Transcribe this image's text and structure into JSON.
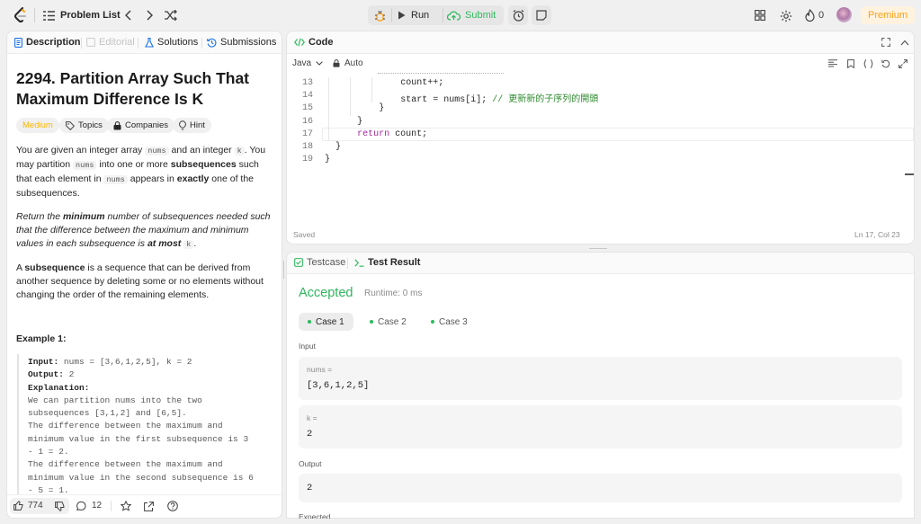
{
  "nav": {
    "problem_list": "Problem List",
    "run": "Run",
    "submit": "Submit",
    "streak": "0",
    "premium": "Premium"
  },
  "left_tabs": {
    "description": "Description",
    "editorial": "Editorial",
    "solutions": "Solutions",
    "submissions": "Submissions"
  },
  "problem": {
    "title_line1": "2294. Partition Array Such That",
    "title_line2": "Maximum Difference Is K",
    "difficulty": "Medium",
    "topics": "Topics",
    "companies": "Companies",
    "hint": "Hint",
    "p1": [
      {
        "t": "You are given an integer array "
      },
      {
        "c": "nums"
      },
      {
        "t": " and an integer "
      },
      {
        "c": "k"
      },
      {
        "t": ". You may partition "
      },
      {
        "c": "nums"
      },
      {
        "t": " into one or more "
      },
      {
        "b": "subsequences"
      },
      {
        "t": " such that each element in "
      },
      {
        "c": "nums"
      },
      {
        "t": " appears in "
      },
      {
        "b": "exactly"
      },
      {
        "t": " one of the subsequences."
      }
    ],
    "p2": [
      {
        "i": "Return the "
      },
      {
        "bi": "minimum"
      },
      {
        "i": " number of subsequences needed such that the difference between the maximum and minimum values in each subsequence is "
      },
      {
        "bi": "at most"
      },
      {
        "t": " "
      },
      {
        "c": "k"
      },
      {
        "t": "."
      }
    ],
    "p3": [
      {
        "t": "A "
      },
      {
        "b": "subsequence"
      },
      {
        "t": " is a sequence that can be derived from another sequence by deleting some or no elements without changing the order of the remaining elements."
      }
    ],
    "example_title": "Example 1:",
    "example_lines": [
      {
        "label": "Input:",
        "text": " nums = [3,6,1,2,5], k = 2"
      },
      {
        "label": "Output:",
        "text": " 2"
      },
      {
        "label": "Explanation:",
        "text": ""
      },
      {
        "label": "",
        "text": "We can partition nums into the two"
      },
      {
        "label": "",
        "text": "subsequences [3,1,2] and [6,5]."
      },
      {
        "label": "",
        "text": "The difference between the maximum and"
      },
      {
        "label": "",
        "text": "minimum value in the first subsequence is 3"
      },
      {
        "label": "",
        "text": "- 1 = 2."
      },
      {
        "label": "",
        "text": "The difference between the maximum and"
      },
      {
        "label": "",
        "text": "minimum value in the second subsequence is 6"
      },
      {
        "label": "",
        "text": "- 5 = 1."
      }
    ]
  },
  "footer": {
    "likes": "774",
    "comments": "12"
  },
  "code_panel": {
    "title": "Code",
    "language": "Java",
    "auto": "Auto",
    "saved": "Saved",
    "cursor": "Ln 17, Col 23",
    "lines": [
      {
        "n": "13",
        "indent": 7,
        "parts": [
          {
            "t": "count++;"
          }
        ]
      },
      {
        "n": "14",
        "indent": 7,
        "parts": [
          {
            "t": "start = nums[i]; "
          },
          {
            "cm": "// 更新新的子序列的開頭"
          }
        ]
      },
      {
        "n": "15",
        "indent": 5,
        "parts": [
          {
            "t": "}"
          }
        ]
      },
      {
        "n": "16",
        "indent": 3,
        "parts": [
          {
            "t": "}"
          }
        ]
      },
      {
        "n": "17",
        "indent": 3,
        "parts": [
          {
            "kw": "return"
          },
          {
            "t": " count;"
          }
        ]
      },
      {
        "n": "18",
        "indent": 1,
        "parts": [
          {
            "t": "}"
          }
        ]
      },
      {
        "n": "19",
        "indent": 0,
        "parts": [
          {
            "t": "}"
          }
        ]
      }
    ]
  },
  "result_panel": {
    "testcase_tab": "Testcase",
    "result_tab": "Test Result",
    "status": "Accepted",
    "runtime": "Runtime: 0 ms",
    "cases": [
      "Case 1",
      "Case 2",
      "Case 3"
    ],
    "input_label": "Input",
    "var1_name": "nums =",
    "var1_value": "[3,6,1,2,5]",
    "var2_name": "k =",
    "var2_value": "2",
    "output_label": "Output",
    "output_value": "2",
    "expected_label": "Expected"
  },
  "colors": {
    "accepted": "#2db55d",
    "medium": "#ffb800",
    "premium": "#ffa116",
    "premium_bg": "#fff3e0",
    "submit": "#2cbb5d"
  }
}
